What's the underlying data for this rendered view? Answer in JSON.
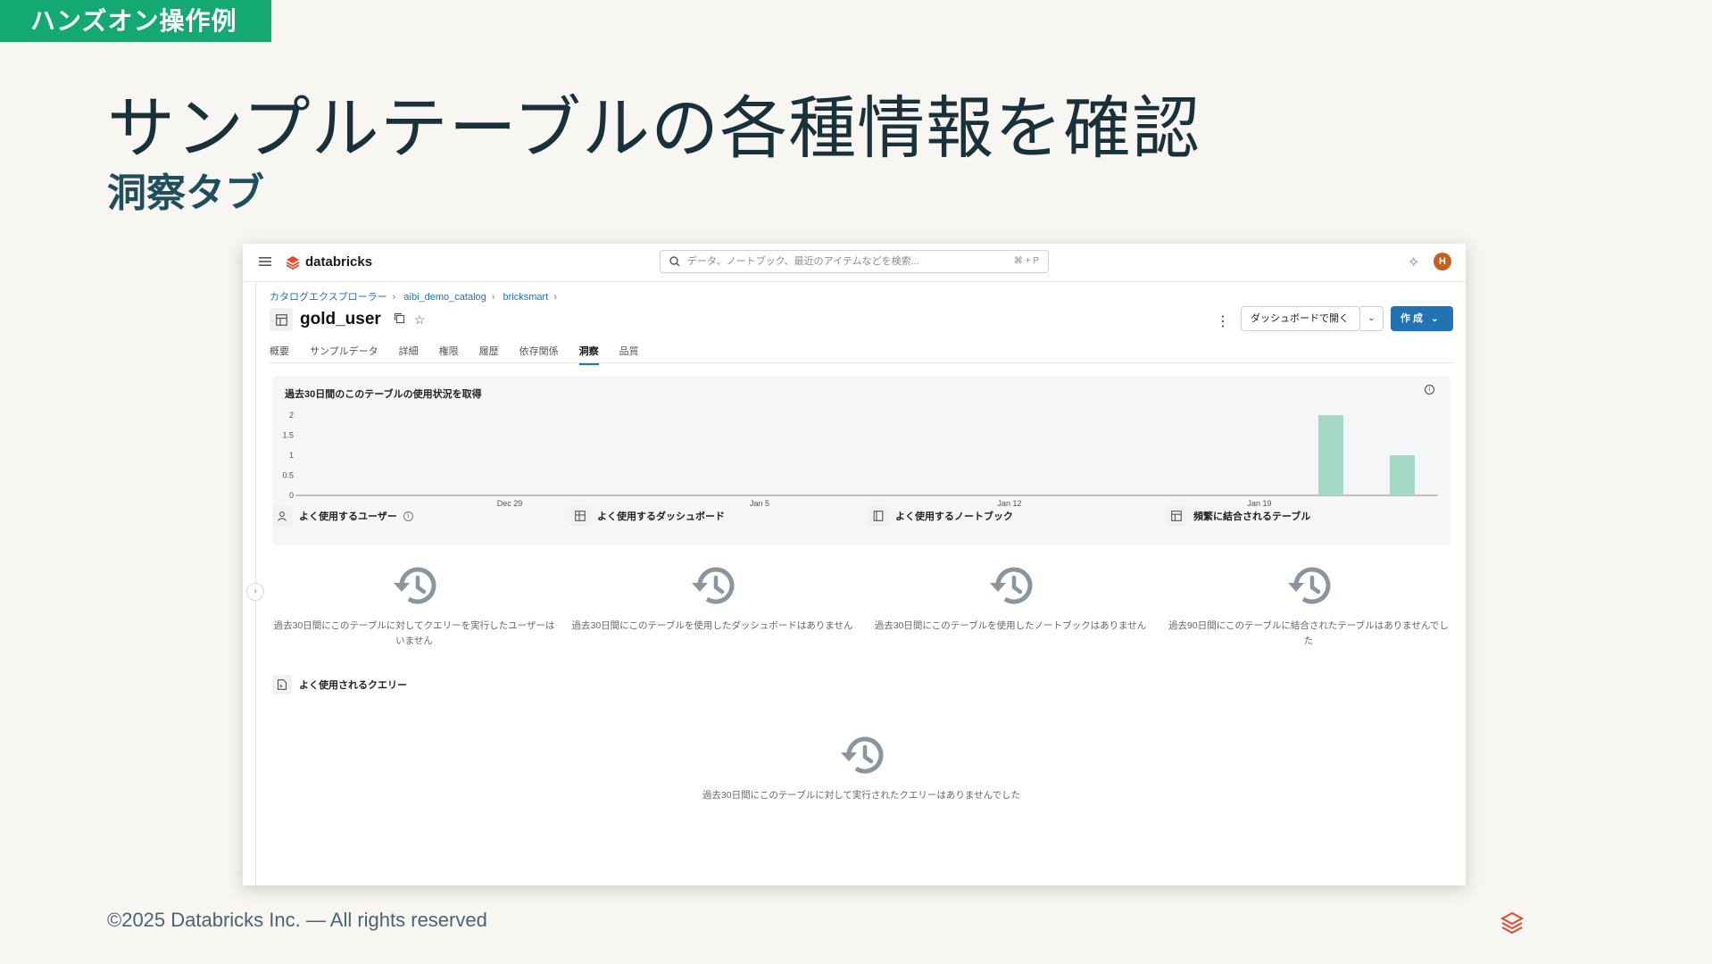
{
  "slide": {
    "badge": "ハンズオン操作例",
    "title": "サンプルテーブルの各種情報を確認",
    "subtitle": "洞察タブ",
    "footer": "©2025 Databricks Inc. — All rights reserved"
  },
  "app": {
    "brand": "databricks",
    "search_placeholder": "データ、ノートブック、最近のアイテムなどを検索...",
    "search_shortcut": "⌘ + P",
    "avatar_initial": "H",
    "accent": "#2272b4"
  },
  "breadcrumb": [
    "カタログエクスプローラー",
    "aibi_demo_catalog",
    "bricksmart"
  ],
  "table": {
    "name": "gold_user"
  },
  "actions": {
    "open_dashboard": "ダッシュボードで開く",
    "create": "作 成"
  },
  "tabs": [
    "概要",
    "サンプルデータ",
    "詳細",
    "権限",
    "履歴",
    "依存関係",
    "洞察",
    "品質"
  ],
  "active_tab": "洞察",
  "usage_chart": {
    "title": "過去30日間のこのテーブルの使用状況を取得"
  },
  "chart_data": {
    "type": "bar",
    "title": "過去30日間のこのテーブルの使用状況を取得",
    "x_ticks": [
      "Dec 29",
      "Jan 5",
      "Jan 12",
      "Jan 19"
    ],
    "y_ticks": [
      "0",
      "0.5",
      "1",
      "1.5",
      "2"
    ],
    "ylim": [
      0,
      2
    ],
    "xlim_days": [
      "Dec 23",
      "Jan 24"
    ],
    "bars": [
      {
        "x": "Jan 21",
        "value": 2
      },
      {
        "x": "Jan 23",
        "value": 1
      }
    ],
    "bar_color": "#a3d9c5",
    "grid": false
  },
  "sections": [
    {
      "title": "よく使用するユーザー",
      "empty": "過去30日間にこのテーブルに対してクエリーを実行したユーザーはいません"
    },
    {
      "title": "よく使用するダッシュボード",
      "empty": "過去30日間にこのテーブルを使用したダッシュボードはありません"
    },
    {
      "title": "よく使用するノートブック",
      "empty": "過去30日間にこのテーブルを使用したノートブックはありません"
    },
    {
      "title": "頻繁に結合されるテーブル",
      "empty": "過去90日間にこのテーブルに結合されたテーブルはありませんでした"
    },
    {
      "title": "よく使用されるクエリー",
      "empty": "過去30日間にこのテーブルに対して実行されたクエリーはありませんでした"
    }
  ]
}
